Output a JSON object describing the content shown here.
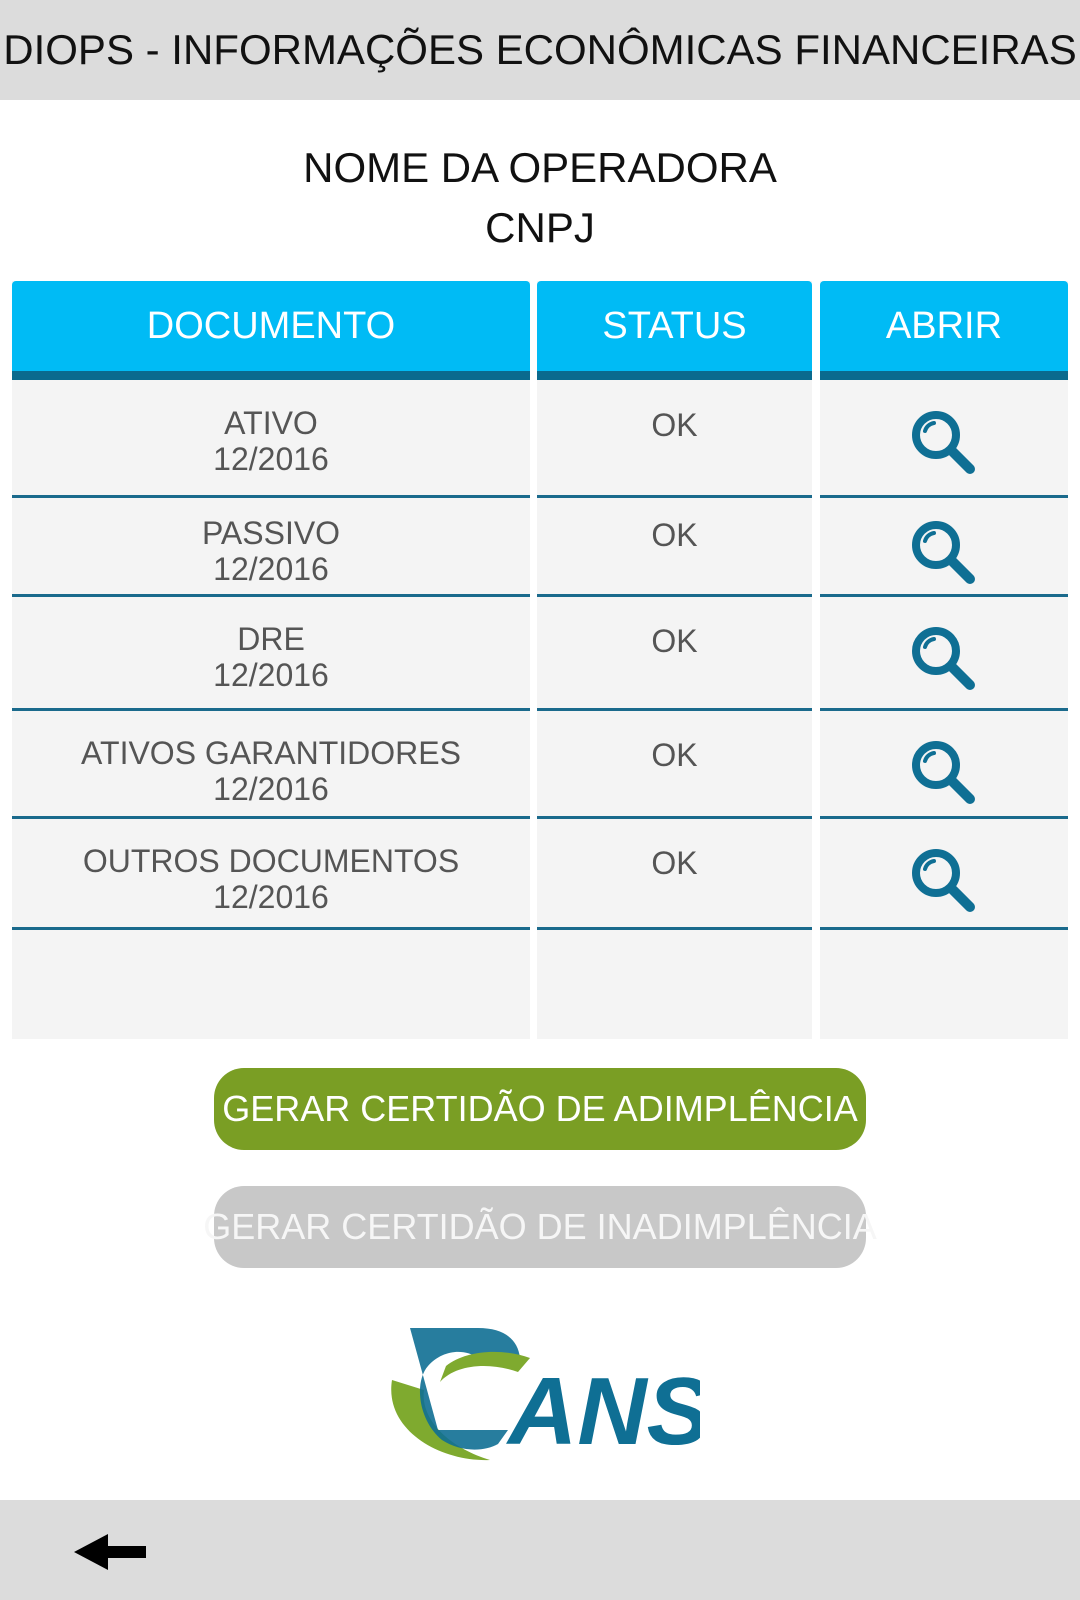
{
  "header": {
    "title": "DIOPS - INFORMAÇÕES ECONÔMICAS FINANCEIRAS"
  },
  "operator": {
    "name": "NOME DA OPERADORA",
    "cnpj": "CNPJ"
  },
  "table": {
    "columns": [
      "DOCUMENTO",
      "STATUS",
      "ABRIR"
    ],
    "rows": [
      {
        "document": "ATIVO",
        "period": "12/2016",
        "status": "OK",
        "open_icon": "magnifier-icon"
      },
      {
        "document": "PASSIVO",
        "period": "12/2016",
        "status": "OK",
        "open_icon": "magnifier-icon"
      },
      {
        "document": "DRE",
        "period": "12/2016",
        "status": "OK",
        "open_icon": "magnifier-icon"
      },
      {
        "document": "ATIVOS GARANTIDORES",
        "period": "12/2016",
        "status": "OK",
        "open_icon": "magnifier-icon"
      },
      {
        "document": "OUTROS DOCUMENTOS",
        "period": "12/2016",
        "status": "OK",
        "open_icon": "magnifier-icon"
      }
    ]
  },
  "actions": {
    "adimplencia_label": "GERAR CERTIDÃO DE ADIMPLÊNCIA",
    "inadimplencia_label": "GERAR CERTIDÃO DE INADIMPLÊNCIA"
  },
  "logo": {
    "text": "ANS"
  },
  "footer": {
    "back_icon": "back-arrow-icon"
  },
  "colors": {
    "header_blue": "#00bbf5",
    "row_divider": "#1a6a8c",
    "button_green": "#7a9e24",
    "button_disabled": "#c8c8c8",
    "icon_blue": "#0f6f94"
  }
}
